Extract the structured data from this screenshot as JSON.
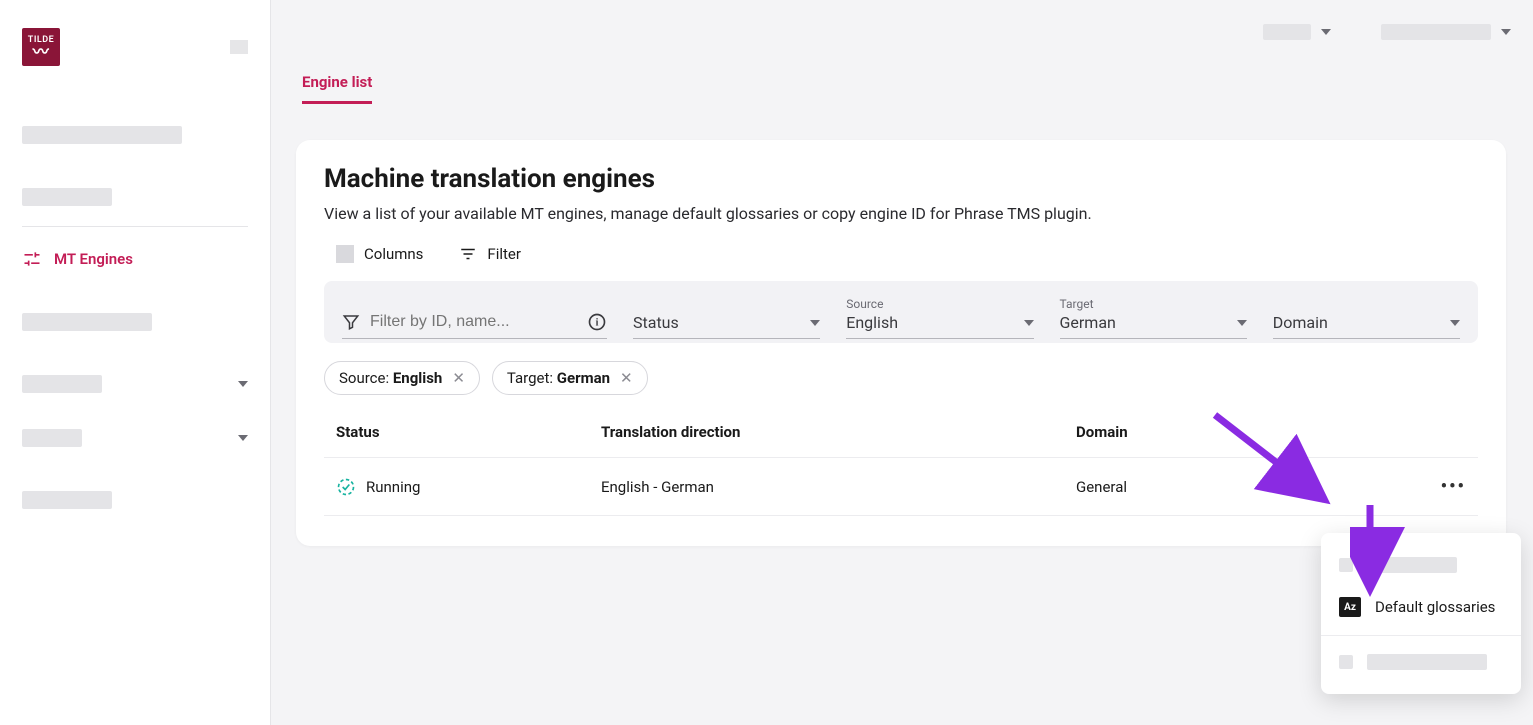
{
  "brand": "TILDE",
  "sidebar": {
    "active_label": "MT Engines"
  },
  "tabs": {
    "engine_list": "Engine list"
  },
  "page": {
    "title": "Machine translation engines",
    "subtitle": "View a list of your available MT engines, manage default glossaries or copy engine ID for Phrase TMS plugin."
  },
  "toolbar": {
    "columns": "Columns",
    "filter": "Filter"
  },
  "filters": {
    "search_placeholder": "Filter by ID, name...",
    "status_label": "Status",
    "source_label": "Source",
    "source_value": "English",
    "target_label": "Target",
    "target_value": "German",
    "domain_label": "Domain"
  },
  "chips": {
    "source_prefix": "Source: ",
    "source_value": "English",
    "target_prefix": "Target: ",
    "target_value": "German"
  },
  "table": {
    "col_status": "Status",
    "col_direction": "Translation direction",
    "col_domain": "Domain",
    "rows": [
      {
        "status": "Running",
        "direction": "English - German",
        "domain": "General"
      }
    ]
  },
  "popup": {
    "default_glossaries": "Default glossaries"
  }
}
